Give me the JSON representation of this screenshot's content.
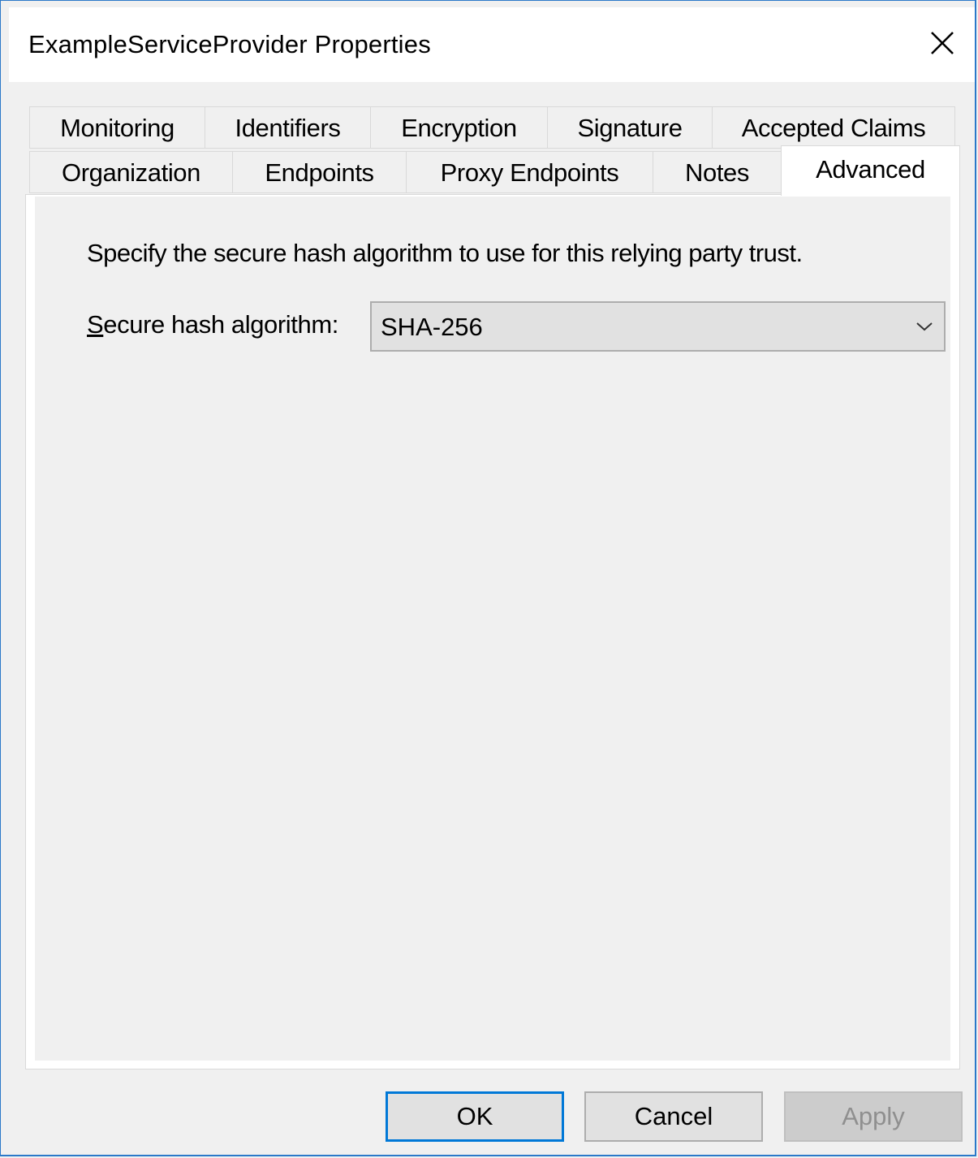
{
  "window": {
    "title": "ExampleServiceProvider Properties",
    "close_icon": "close-icon",
    "accent_color": "#0078d7"
  },
  "tabs": {
    "row1": [
      {
        "label": "Monitoring",
        "active": false
      },
      {
        "label": "Identifiers",
        "active": false
      },
      {
        "label": "Encryption",
        "active": false
      },
      {
        "label": "Signature",
        "active": false
      },
      {
        "label": "Accepted Claims",
        "active": false
      }
    ],
    "row2": [
      {
        "label": "Organization",
        "active": false
      },
      {
        "label": "Endpoints",
        "active": false
      },
      {
        "label": "Proxy Endpoints",
        "active": false
      },
      {
        "label": "Notes",
        "active": false
      },
      {
        "label": "Advanced",
        "active": true
      }
    ]
  },
  "advanced": {
    "description": "Specify the secure hash algorithm to use for this relying party trust.",
    "hash_label_first": "S",
    "hash_label_rest": "ecure hash algorithm:",
    "hash_value": "SHA-256",
    "dropdown_icon": "chevron-down-icon"
  },
  "buttons": {
    "ok": {
      "label": "OK",
      "enabled": true,
      "default": true
    },
    "cancel": {
      "label": "Cancel",
      "enabled": true
    },
    "apply": {
      "label": "Apply",
      "enabled": false
    }
  }
}
